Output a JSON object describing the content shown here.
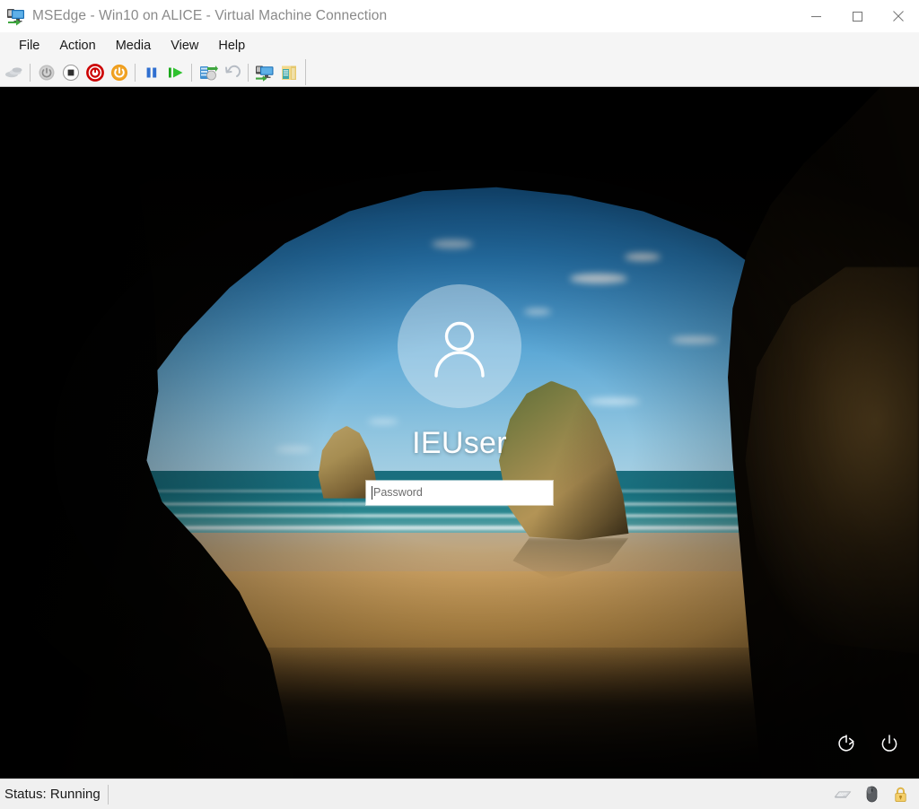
{
  "window": {
    "title": "MSEdge - Win10 on ALICE - Virtual Machine Connection",
    "app_icon": "vm-connection-icon",
    "controls": {
      "minimize": "minimize-icon",
      "maximize": "maximize-icon",
      "close": "close-icon"
    }
  },
  "menubar": {
    "items": [
      {
        "label": "File"
      },
      {
        "label": "Action"
      },
      {
        "label": "Media"
      },
      {
        "label": "View"
      },
      {
        "label": "Help"
      }
    ]
  },
  "toolbar": {
    "buttons": [
      {
        "name": "ctrl-alt-delete-icon",
        "title": "Ctrl+Alt+Delete",
        "enabled": false
      },
      {
        "name": "start-icon",
        "title": "Start",
        "enabled": false
      },
      {
        "name": "turn-off-icon",
        "title": "Turn Off",
        "enabled": true
      },
      {
        "name": "shut-down-icon",
        "title": "Shut Down",
        "enabled": true
      },
      {
        "name": "save-state-icon",
        "title": "Save",
        "enabled": true
      },
      {
        "name": "pause-icon",
        "title": "Pause",
        "enabled": true
      },
      {
        "name": "reset-icon",
        "title": "Reset",
        "enabled": true
      },
      {
        "name": "checkpoint-icon",
        "title": "Checkpoint",
        "enabled": true
      },
      {
        "name": "revert-icon",
        "title": "Revert",
        "enabled": false
      },
      {
        "name": "enhanced-session-icon",
        "title": "Enhanced Session",
        "enabled": true
      },
      {
        "name": "share-icon",
        "title": "Share",
        "enabled": true
      }
    ]
  },
  "lockscreen": {
    "avatar_icon": "user-avatar-icon",
    "username": "IEUser",
    "password": {
      "value": "",
      "placeholder": "Password"
    },
    "submit_icon": "submit-arrow-icon",
    "bottom_icons": [
      {
        "name": "ease-of-access-icon"
      },
      {
        "name": "power-icon"
      }
    ],
    "wallpaper": {
      "description": "Wharariki Beach cave with Archway Islands",
      "sky_color": "#1565a8",
      "sand_color": "#c9994f",
      "sea_color": "#2f8c93"
    }
  },
  "statusbar": {
    "status_text": "Status: Running",
    "icons": [
      {
        "name": "keyboard-icon"
      },
      {
        "name": "mouse-icon"
      },
      {
        "name": "lock-icon"
      }
    ]
  }
}
